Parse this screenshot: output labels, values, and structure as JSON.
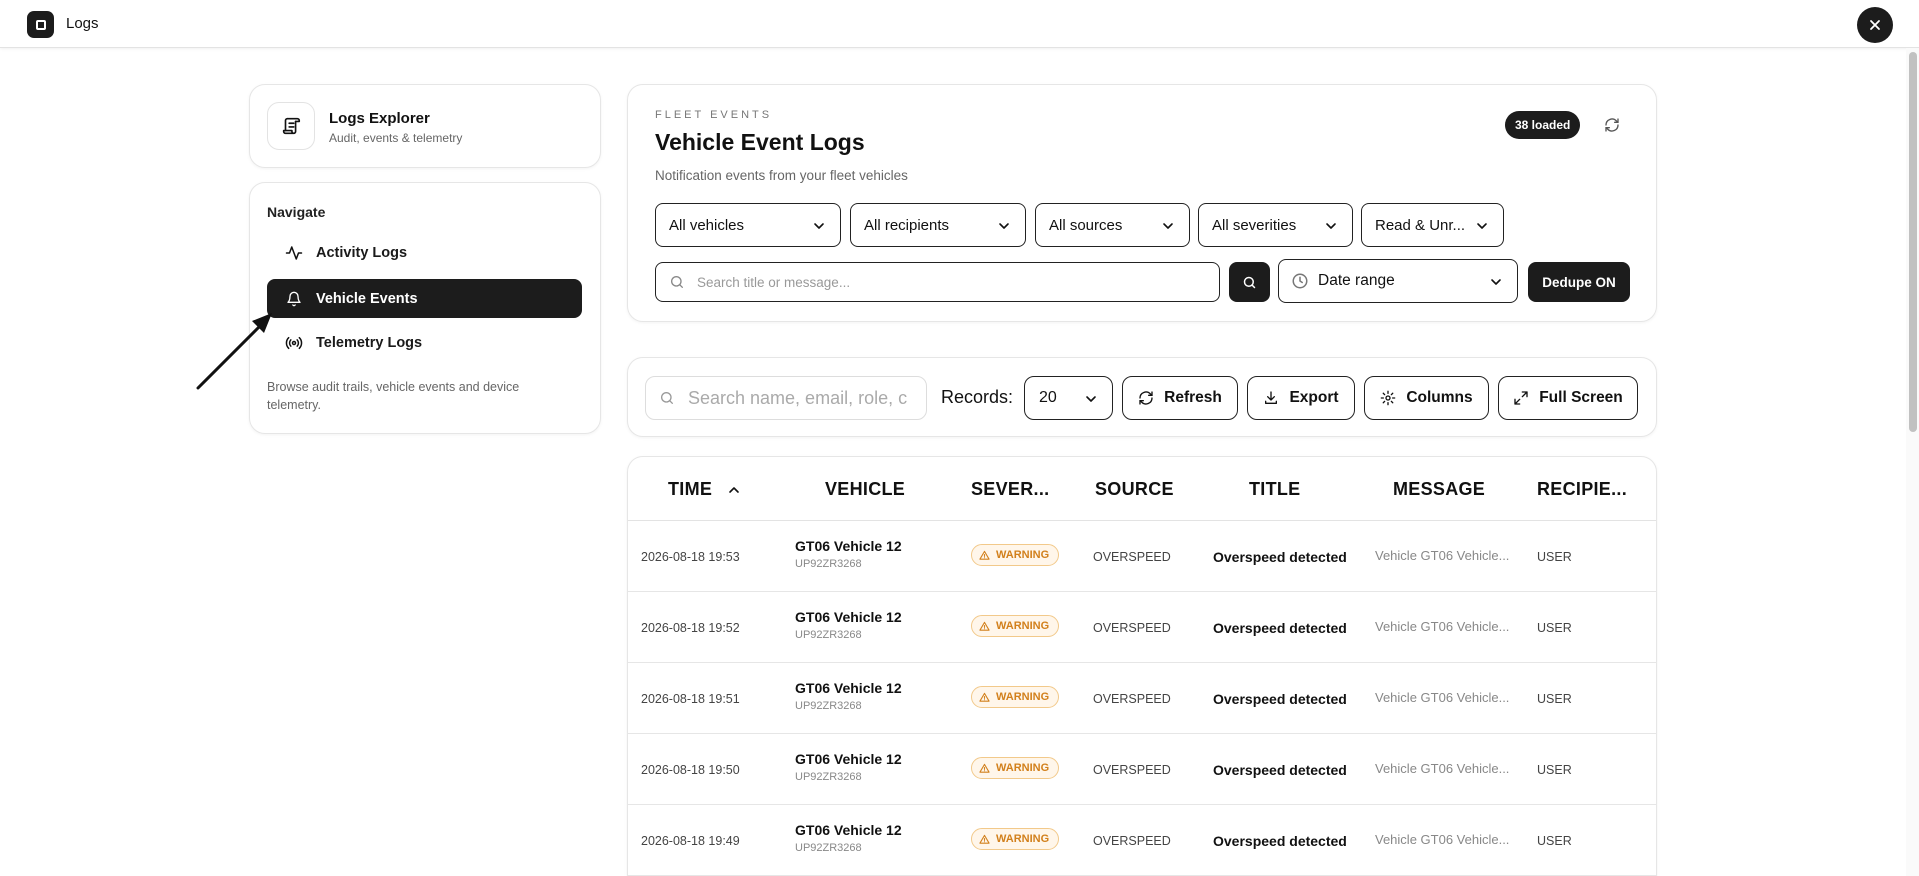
{
  "app": {
    "title": "Logs"
  },
  "explorer": {
    "title": "Logs Explorer",
    "subtitle": "Audit, events & telemetry"
  },
  "nav": {
    "heading": "Navigate",
    "items": [
      {
        "label": "Activity Logs",
        "icon": "activity-icon",
        "active": false
      },
      {
        "label": "Vehicle Events",
        "icon": "bell-icon",
        "active": true
      },
      {
        "label": "Telemetry Logs",
        "icon": "broadcast-icon",
        "active": false
      }
    ],
    "description": "Browse audit trails, vehicle events and device telemetry."
  },
  "header": {
    "eyebrow": "FLEET EVENTS",
    "title": "Vehicle Event Logs",
    "subtitle": "Notification events from your fleet vehicles",
    "loaded_badge": "38 loaded"
  },
  "filters": {
    "vehicles": "All vehicles",
    "recipients": "All recipients",
    "sources": "All sources",
    "severities": "All severities",
    "read_state": "Read & Unr...",
    "search_placeholder": "Search title or message...",
    "date_range": "Date range",
    "dedupe": "Dedupe ON"
  },
  "toolbar": {
    "search_placeholder": "Search name, email, role, c",
    "records_label": "Records:",
    "records_value": "20",
    "refresh": "Refresh",
    "export": "Export",
    "columns": "Columns",
    "fullscreen": "Full Screen"
  },
  "table": {
    "columns": [
      "TIME",
      "VEHICLE",
      "SEVER...",
      "SOURCE",
      "TITLE",
      "MESSAGE",
      "RECIPIE..."
    ],
    "rows": [
      {
        "time": "2026-08-18 19:53",
        "vehicle": "GT06 Vehicle 12",
        "plate": "UP92ZR3268",
        "severity": "WARNING",
        "source": "OVERSPEED",
        "title": "Overspeed detected",
        "message": "Vehicle GT06 Vehicle...",
        "recipient": "USER"
      },
      {
        "time": "2026-08-18 19:52",
        "vehicle": "GT06 Vehicle 12",
        "plate": "UP92ZR3268",
        "severity": "WARNING",
        "source": "OVERSPEED",
        "title": "Overspeed detected",
        "message": "Vehicle GT06 Vehicle...",
        "recipient": "USER"
      },
      {
        "time": "2026-08-18 19:51",
        "vehicle": "GT06 Vehicle 12",
        "plate": "UP92ZR3268",
        "severity": "WARNING",
        "source": "OVERSPEED",
        "title": "Overspeed detected",
        "message": "Vehicle GT06 Vehicle...",
        "recipient": "USER"
      },
      {
        "time": "2026-08-18 19:50",
        "vehicle": "GT06 Vehicle 12",
        "plate": "UP92ZR3268",
        "severity": "WARNING",
        "source": "OVERSPEED",
        "title": "Overspeed detected",
        "message": "Vehicle GT06 Vehicle...",
        "recipient": "USER"
      },
      {
        "time": "2026-08-18 19:49",
        "vehicle": "GT06 Vehicle 12",
        "plate": "UP92ZR3268",
        "severity": "WARNING",
        "source": "OVERSPEED",
        "title": "Overspeed detected",
        "message": "Vehicle GT06 Vehicle...",
        "recipient": "USER"
      }
    ]
  },
  "colors": {
    "dark": "#1c1c1c",
    "warning": "#d2801c",
    "warning_bg": "#fff6ea"
  }
}
